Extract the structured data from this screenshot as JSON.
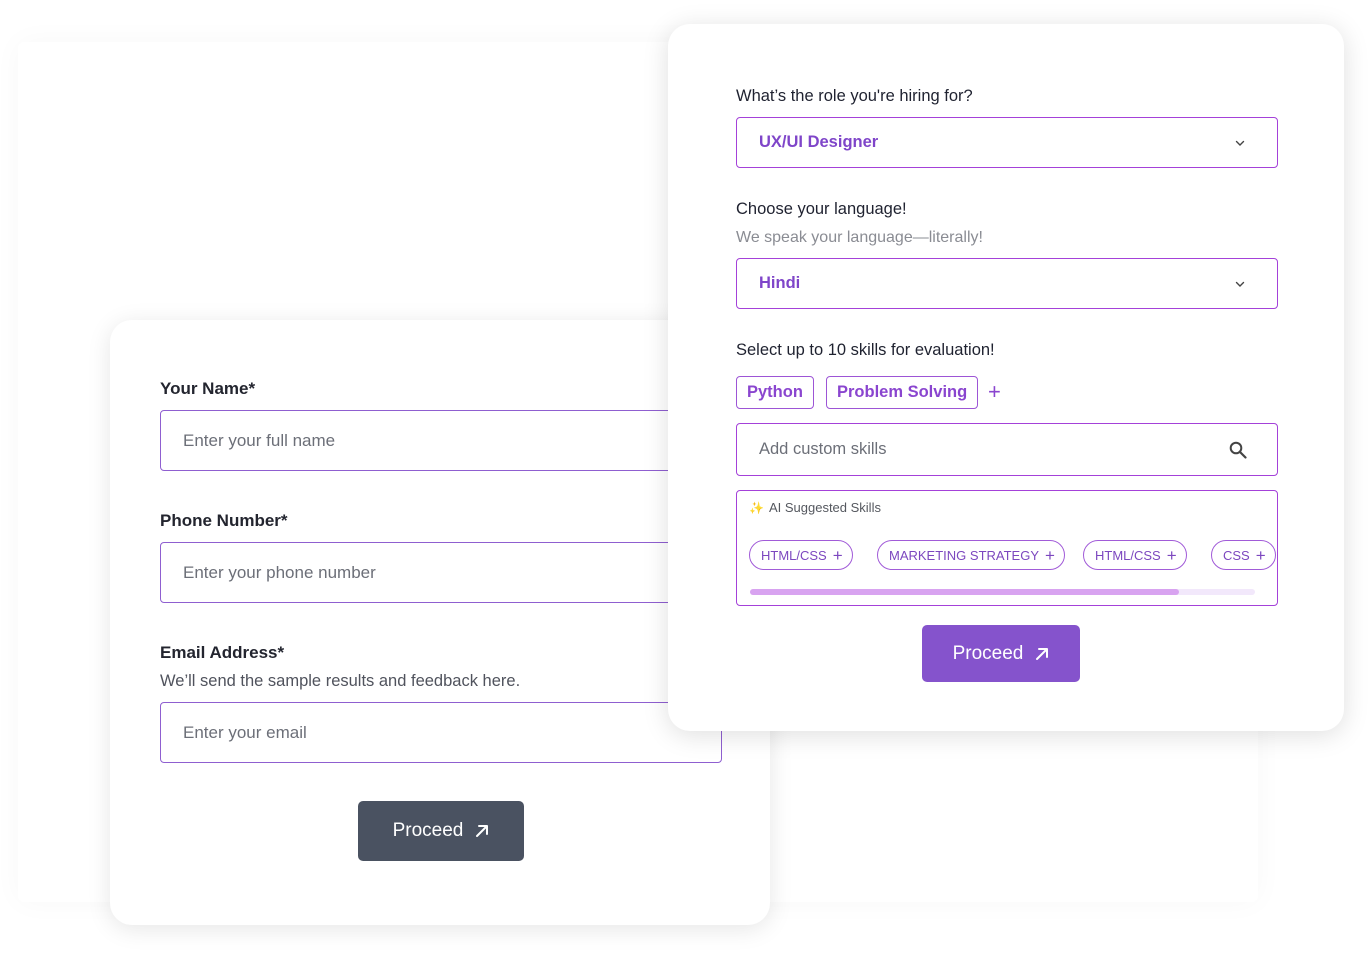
{
  "personal_form": {
    "name_label": "Your Name*",
    "name_placeholder": "Enter your full name",
    "phone_label": "Phone Number*",
    "phone_placeholder": "Enter your phone number",
    "email_label": "Email Address*",
    "email_hint": "We’ll send the sample results and feedback here.",
    "email_placeholder": "Enter your email",
    "proceed_label": "Proceed",
    "proceed_icon": "arrow-up-right-icon"
  },
  "hiring_form": {
    "role_question": "What’s the role you're hiring for?",
    "role_value": "UX/UI Designer",
    "language_question": "Choose your language!",
    "language_hint": "We speak your language—literally!",
    "language_value": "Hindi",
    "skills_question": "Select up to 10 skills for evaluation!",
    "selected_skills": [
      "Python",
      "Problem Solving"
    ],
    "add_skill_symbol": "+",
    "custom_skill_placeholder": "Add custom skills",
    "ai_suggested_title": "AI Suggested Skills",
    "ai_suggested_skills": [
      "HTML/CSS",
      "MARKETING STRATEGY",
      "HTML/CSS",
      "CSS"
    ],
    "suggestion_scroll_progress": 0.85,
    "proceed_label": "Proceed",
    "proceed_icon": "arrow-up-right-icon"
  },
  "colors": {
    "accent_purple": "#8553cc",
    "input_border": "#a441d9",
    "dark_button": "#4a5261"
  }
}
